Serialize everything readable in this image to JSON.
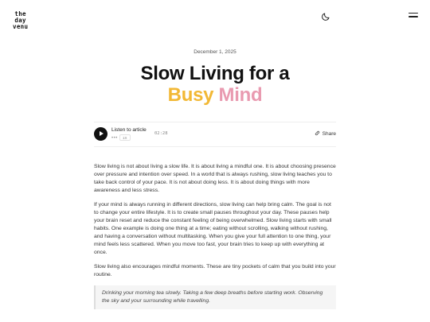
{
  "header": {
    "logo_lines": [
      "the",
      "day",
      "venu"
    ],
    "theme_toggle": "moon-icon",
    "menu": "hamburger-icon"
  },
  "article": {
    "date": "December 1, 2025",
    "title_line1": "Slow Living for a",
    "title_word1": "Busy",
    "title_word2": "Mind",
    "colors": {
      "busy": "#f2b835",
      "mind": "#e99ab0"
    }
  },
  "audio": {
    "label": "Listen to article",
    "dots": "•••",
    "speed": "1X",
    "time": "02:28",
    "share": "Share"
  },
  "body": {
    "paragraphs": [
      "Slow living is not about living a slow life. It is about living a mindful one. It is about choosing presence over pressure and intention over speed. In a world that is always rushing, slow living teaches you to take back control of your pace. It is not about doing less. It is about doing things with more awareness and less stress.",
      "If your mind is always running in different directions, slow living can help bring calm. The goal is not to change your entire lifestyle. It is to create small pauses throughout your day. These pauses help your brain reset and reduce the constant feeling of being overwhelmed. Slow living starts with small habits. One example is doing one thing at a time; eating without scrolling, walking without rushing, and having a conversation without multitasking. When you give your full attention to one thing, your mind feels less scattered. When you move too fast, your brain tries to keep up with everything at once.",
      "Slow living also encourages mindful moments. These are tiny pockets of calm that you build into your routine."
    ],
    "quote": "Drinking your morning tea slowly. Taking a few deep breaths before starting work. Observing the sky and your surrounding while travelling."
  }
}
